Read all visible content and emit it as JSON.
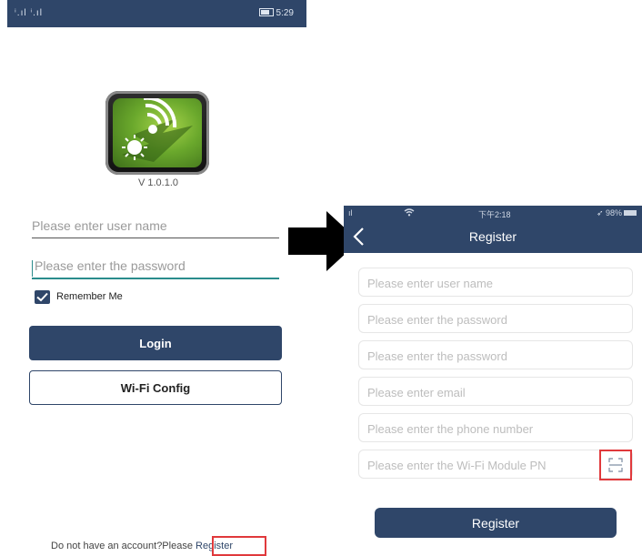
{
  "login": {
    "status_bar": {
      "signal": "ⁱ.ıl ⁱ.ıl",
      "battery": "(85)",
      "time": "5:29"
    },
    "version": "V 1.0.1.0",
    "username_placeholder": "Please enter user name",
    "password_placeholder": "Please enter the password",
    "remember_me": "Remember Me",
    "login_button": "Login",
    "wifi_config_button": "Wi-Fi Config",
    "no_account_text": "Do not have an account?Please ",
    "register_link": "Register"
  },
  "register": {
    "status_bar": {
      "signal": "ıl",
      "time": "下午2:18",
      "battery": "98%"
    },
    "title": "Register",
    "fields": [
      "Please enter user name",
      "Please enter the password",
      "Please enter the password",
      "Please enter email",
      "Please enter the phone number",
      "Please enter the Wi-Fi Module PN"
    ],
    "register_button": "Register"
  },
  "colors": {
    "navy": "#2f4669",
    "highlight_red": "#e0393c",
    "teal_underline": "#2a8c8c"
  },
  "icons": [
    "signal-icon",
    "battery-icon",
    "app-logo-icon",
    "checkbox-checked-icon",
    "transition-arrow-icon",
    "back-chevron-icon",
    "wifi-icon",
    "location-icon",
    "scan-icon"
  ]
}
